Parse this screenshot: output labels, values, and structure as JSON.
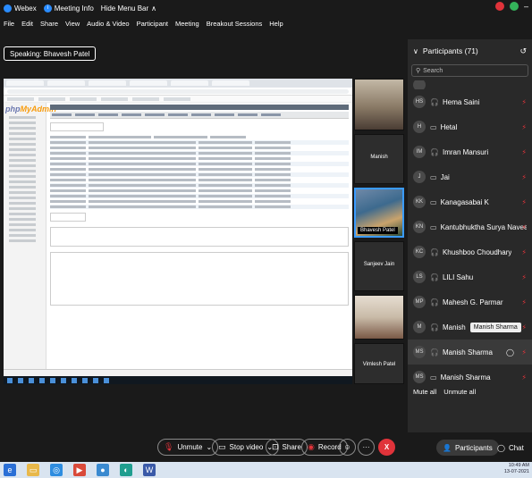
{
  "titlebar": {
    "app": "Webex",
    "meeting_info": "Meeting Info",
    "hide_menu": "Hide Menu Bar",
    "hide_menu_chev": "∧",
    "minimize": "–",
    "colors": {
      "record_dot": "#e0333a",
      "status_dot": "#34b35a"
    }
  },
  "menu": [
    "File",
    "Edit",
    "Share",
    "View",
    "Audio & Video",
    "Participant",
    "Meeting",
    "Breakout Sessions",
    "Help"
  ],
  "speaking": "Speaking: Bhavesh Patel",
  "share": {
    "app_logo_a": "php",
    "app_logo_b": "MyAdmin",
    "content": "phpMyAdmin database table listing in browser"
  },
  "videos": [
    {
      "name": "",
      "photo": "photo-a"
    },
    {
      "name": "Manish",
      "photo": ""
    },
    {
      "name": "Bhavesh Patel",
      "photo": "photo-b"
    },
    {
      "name": "Sanjeev Jain",
      "photo": ""
    },
    {
      "name": "",
      "photo": "photo-c"
    },
    {
      "name": "Vimlesh Patel",
      "photo": ""
    }
  ],
  "participants": {
    "title": "Participants (71)",
    "search_placeholder": "Search",
    "items": [
      {
        "initials": "HS",
        "name": "Hema Saini",
        "device": "headset-icon",
        "glyph": "🎧"
      },
      {
        "initials": "H",
        "name": "Hetal",
        "device": "desktop-icon",
        "glyph": "▭"
      },
      {
        "initials": "IM",
        "name": "Imran Mansuri",
        "device": "headset-icon",
        "glyph": "🎧"
      },
      {
        "initials": "J",
        "name": "Jai",
        "device": "desktop-icon",
        "glyph": "▭"
      },
      {
        "initials": "KK",
        "name": "Kanagasabai K",
        "device": "desktop-icon",
        "glyph": "▭"
      },
      {
        "initials": "KN",
        "name": "Kantubhuktha Surya Naveen",
        "device": "desktop-icon",
        "glyph": "▭"
      },
      {
        "initials": "KC",
        "name": "Khushboo Choudhary",
        "device": "headset-icon",
        "glyph": "🎧"
      },
      {
        "initials": "LS",
        "name": "LILI Sahu",
        "device": "headset-icon",
        "glyph": "🎧"
      },
      {
        "initials": "MP",
        "name": "Mahesh G. Parmar",
        "device": "headset-icon",
        "glyph": "🎧"
      },
      {
        "initials": "M",
        "name": "Manish",
        "device": "headset-icon",
        "glyph": "🎧",
        "tooltip": "Manish Sharma"
      },
      {
        "initials": "MS",
        "name": "Manish Sharma",
        "device": "headset-icon",
        "glyph": "🎧"
      },
      {
        "initials": "MS",
        "name": "Manish Sharma",
        "device": "desktop-icon",
        "glyph": "▭"
      }
    ],
    "mute_all": "Mute all",
    "unmute_all": "Unmute all"
  },
  "controls": {
    "unmute": "Unmute",
    "stop_video": "Stop video",
    "share": "Share",
    "record": "Record",
    "more": "···",
    "end": "X",
    "participants": "Participants",
    "chat": "Chat"
  },
  "taskbar": {
    "time": "10:49 AM",
    "date": "13-07-2021"
  }
}
